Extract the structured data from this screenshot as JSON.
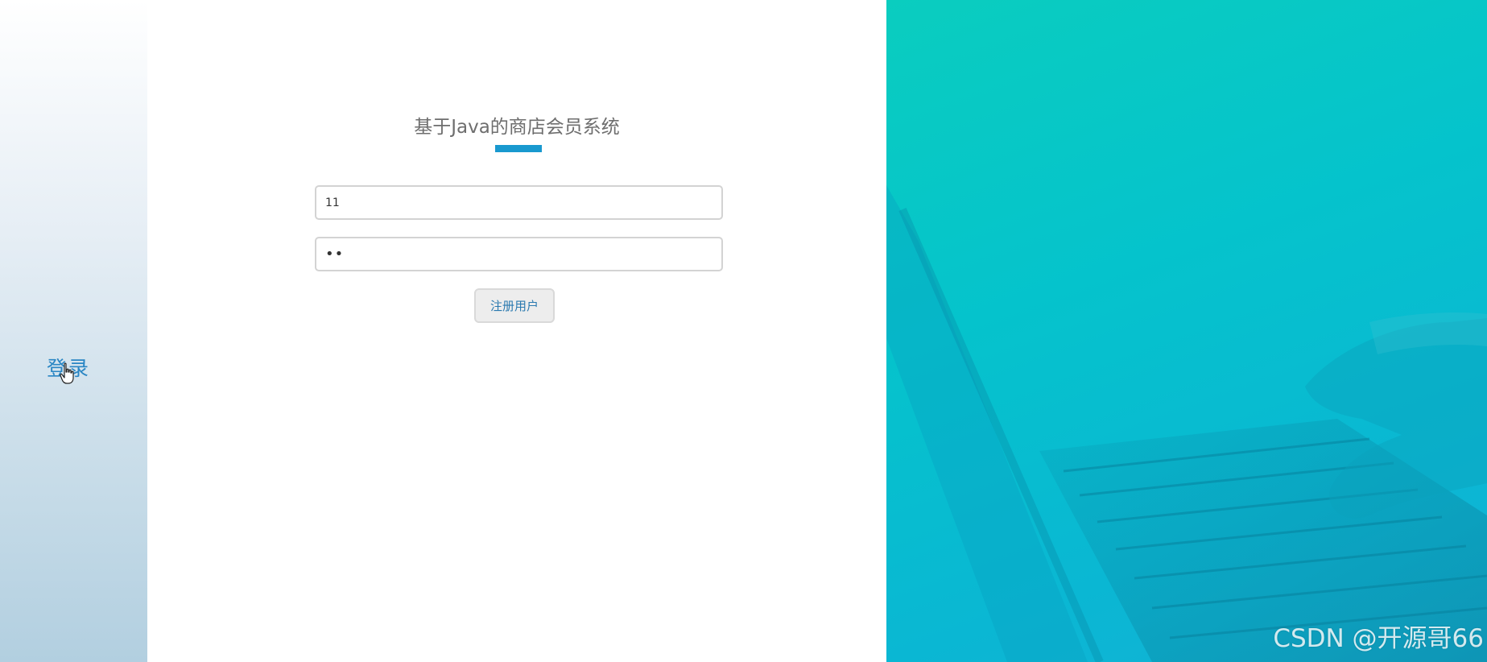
{
  "sidebar": {
    "login_label": "登录",
    "cursor_icon": "hand-pointer-icon"
  },
  "form": {
    "title": "基于Java的商店会员系统",
    "username_value": "11",
    "password_value": "••",
    "register_label": "注册用户"
  },
  "colors": {
    "accent": "#1999cf",
    "link": "#2a86c4",
    "hero_start": "#0acdbf",
    "hero_end": "#14b1d5"
  },
  "watermark": {
    "text": "CSDN @开源哥66"
  }
}
